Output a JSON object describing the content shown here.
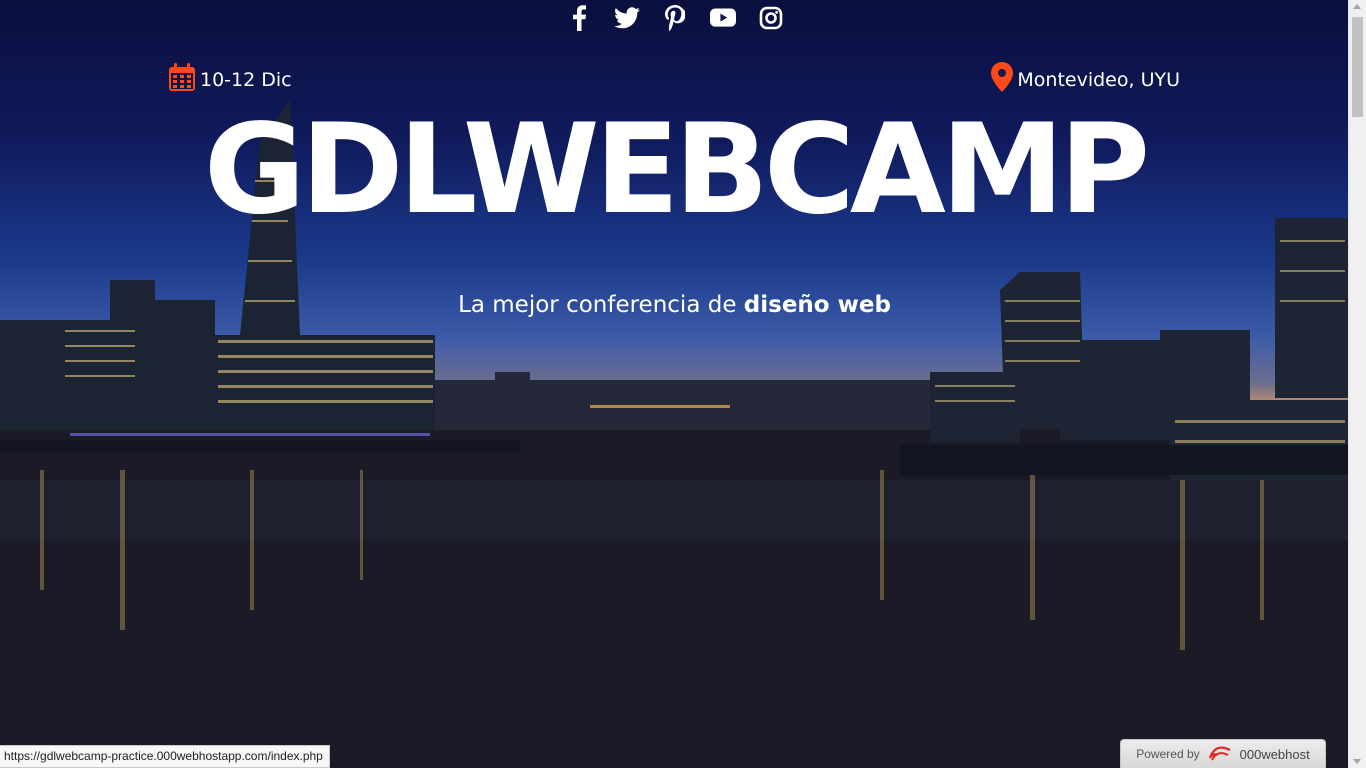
{
  "social": {
    "icons": [
      "facebook-icon",
      "twitter-icon",
      "pinterest-icon",
      "youtube-icon",
      "instagram-icon"
    ]
  },
  "event": {
    "date": "10-12 Dic",
    "location": "Montevideo, UYU"
  },
  "hero": {
    "title": "GDLWEBCAMP",
    "slogan_prefix": "La mejor conferencia de",
    "slogan_bold": "diseño web"
  },
  "status_bar": {
    "url": "https://gdlwebcamp-practice.000webhostapp.com/index.php"
  },
  "badge": {
    "powered_by": "Powered by",
    "brand": "000webhost"
  },
  "colors": {
    "accent": "#fe4918",
    "text": "#ffffff"
  }
}
